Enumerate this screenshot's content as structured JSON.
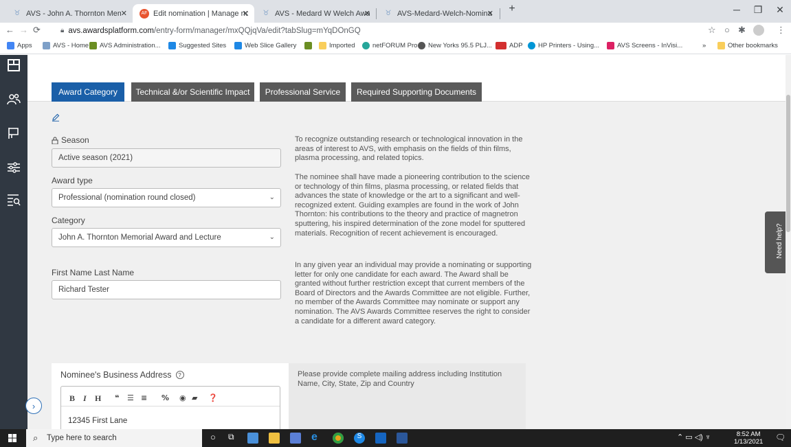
{
  "browser": {
    "tabs": [
      {
        "label": "AVS - John A. Thornton Memoria",
        "active": false
      },
      {
        "label": "Edit nomination | Manage nomin",
        "active": true
      },
      {
        "label": "AVS - Medard W Welch Award",
        "active": false
      },
      {
        "label": "AVS-Medard-Welch-Nomination",
        "active": false
      }
    ],
    "url_host": "avs.awardsplatform.com",
    "url_path": "/entry-form/manager/mxQQjqVa/edit?tabSlug=mYqDOnGQ",
    "bookmarks": [
      {
        "label": "Apps",
        "color": "#4285f4"
      },
      {
        "label": "AVS - Home",
        "color": "#7ea0c8"
      },
      {
        "label": "AVS Administration...",
        "color": "#6b8e23"
      },
      {
        "label": "Suggested Sites",
        "color": "#1e88e5"
      },
      {
        "label": "Web Slice Gallery",
        "color": "#1e88e5"
      },
      {
        "label": "",
        "color": "#6b8e23"
      },
      {
        "label": "Imported",
        "color": "#f9ce5b"
      },
      {
        "label": "netFORUM Pro",
        "color": "#26a69a"
      },
      {
        "label": "New Yorks 95.5 PLJ...",
        "color": "#555555"
      },
      {
        "label": "ADP",
        "color": "#d32f2f"
      },
      {
        "label": "HP Printers - Using...",
        "color": "#0096d6"
      },
      {
        "label": "AVS Screens - InVisi...",
        "color": "#dc2163"
      },
      {
        "label": "»",
        "color": ""
      },
      {
        "label": "Other bookmarks",
        "color": "#f9ce5b"
      }
    ]
  },
  "form": {
    "tabs": [
      {
        "label": "Award Category",
        "active": true
      },
      {
        "label": "Technical &/or Scientific Impact",
        "active": false
      },
      {
        "label": "Professional Service",
        "active": false
      },
      {
        "label": "Required Supporting Documents",
        "active": false
      }
    ],
    "season_label": "Season",
    "season_value": "Active season (2021)",
    "award_type_label": "Award type",
    "award_type_value": "Professional (nomination round closed)",
    "category_label": "Category",
    "category_value": "John A. Thornton Memorial Award and Lecture",
    "name_label": "First Name Last Name",
    "name_value": "Richard Tester",
    "description": [
      "To recognize outstanding research or technological innovation in the areas of interest to AVS, with emphasis on the fields of thin films, plasma processing, and related topics.",
      "The nominee shall have made a pioneering contribution to the science or technology of thin films, plasma processing, or related fields that advances the state of knowledge or the art to a significant and well-recognized extent. Guiding examples are found in the work of John Thornton: his contributions to the theory and practice of magnetron sputtering, his inspired determination of the zone model for sputtered materials. Recognition of recent achievement is encouraged.",
      "In any given year an individual may provide a nominating or supporting letter for only one candidate for each award. The Award shall be granted without further restriction except that current members of the Board of Directors and the Awards Committee are not eligible. Further, no member of the Awards Committee may nominate or support any nomination. The AVS Awards Committee reserves the right to consider a candidate for a different award category."
    ],
    "address_label": "Nominee's Business Address",
    "address_hint": "Please provide complete mailing address including Institution Name, City, State, Zip and Country",
    "address_value": "12345 First Lane"
  },
  "need_help": "Need help?",
  "taskbar": {
    "search_placeholder": "Type here to search",
    "time": "8:52 AM",
    "date": "1/13/2021"
  },
  "colors": {
    "active_tab": "#1a5fa8",
    "inactive_tab": "#5a5a5a",
    "sidebar": "#303842"
  }
}
